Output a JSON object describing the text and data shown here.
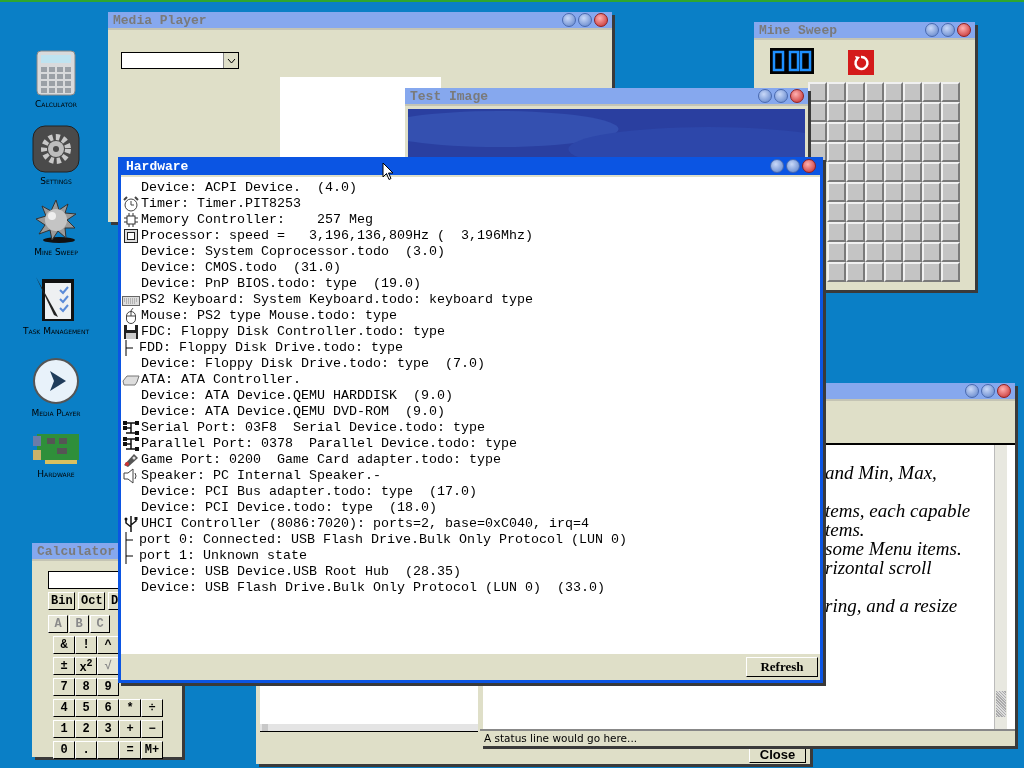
{
  "desktop_icons": [
    {
      "kind": "calculator",
      "label": "Calculator"
    },
    {
      "kind": "settings",
      "label": "Settings"
    },
    {
      "kind": "mine",
      "label": "Mine Sweep"
    },
    {
      "kind": "tasks",
      "label": "Task Management"
    },
    {
      "kind": "media",
      "label": "Media Player"
    },
    {
      "kind": "hardware",
      "label": "Hardware"
    }
  ],
  "media_player": {
    "title": "Media Player",
    "active": false
  },
  "close_window": {
    "button": "Close"
  },
  "text_window": {
    "active": false,
    "paragraphs": [
      [
        "and Min, Max,"
      ],
      [
        "tems, each capable",
        "tems.",
        "some Menu items.",
        "rizontal scroll"
      ],
      [
        "ring, and a resize"
      ]
    ],
    "status": "A status line would go here..."
  },
  "test_image": {
    "title": "Test Image",
    "active": false
  },
  "mine_sweep": {
    "title": "Mine Sweep",
    "active": false
  },
  "calculator": {
    "title": "Calculator",
    "active": false,
    "rows": [
      [
        {
          "label": "Bin",
          "disabled": false
        },
        {
          "label": "Oct",
          "disabled": false
        },
        {
          "label": "D",
          "disabled": false
        }
      ],
      [
        {
          "label": "A",
          "disabled": true
        },
        {
          "label": "B",
          "disabled": true
        },
        {
          "label": "C",
          "disabled": true
        }
      ],
      [
        {
          "label": "&",
          "disabled": false
        },
        {
          "label": "!",
          "disabled": false
        },
        {
          "label": "^",
          "disabled": false
        }
      ],
      [
        {
          "label": "±",
          "disabled": false
        },
        {
          "label": "x$^{2}$",
          "disabled": false
        },
        {
          "label": "√",
          "disabled": true
        }
      ],
      [
        {
          "label": "7",
          "disabled": false
        },
        {
          "label": "8",
          "disabled": false
        },
        {
          "label": "9",
          "disabled": false
        }
      ],
      [
        {
          "label": "4",
          "disabled": false
        },
        {
          "label": "5",
          "disabled": false
        },
        {
          "label": "6",
          "disabled": false
        },
        {
          "label": "*",
          "disabled": false
        },
        {
          "label": "÷",
          "disabled": false
        }
      ],
      [
        {
          "label": "1",
          "disabled": false
        },
        {
          "label": "2",
          "disabled": false
        },
        {
          "label": "3",
          "disabled": false
        },
        {
          "label": "+",
          "disabled": false
        },
        {
          "label": "−",
          "disabled": false
        }
      ],
      [
        {
          "label": "0",
          "disabled": false
        },
        {
          "label": ".",
          "disabled": false
        },
        {
          "disabled": false
        },
        {
          "label": "=",
          "disabled": false
        },
        {
          "label": "M+",
          "disabled": false
        }
      ]
    ]
  },
  "hardware": {
    "title": "Hardware",
    "active": true,
    "button": "Refresh",
    "lines": [
      {
        "kind": "device",
        "text": "Device: ACPI Device.  (4.0)"
      },
      {
        "kind": "timer",
        "text": "Timer: Timer.PIT8253"
      },
      {
        "kind": "memory",
        "text": "Memory Controller:    257 Meg"
      },
      {
        "kind": "processor",
        "text": "Processor: speed =   3,196,136,809Hz (  3,196Mhz)"
      },
      {
        "kind": "device",
        "text": "Device: System Coprocessor.todo  (3.0)"
      },
      {
        "kind": "device",
        "text": "Device: CMOS.todo  (31.0)"
      },
      {
        "kind": "device",
        "text": "Device: PnP BIOS.todo: type  (19.0)"
      },
      {
        "kind": "keyboard",
        "text": "PS2 Keyboard: System Keyboard.todo: keyboard type"
      },
      {
        "kind": "mouse",
        "text": "Mouse: PS2 type Mouse.todo: type"
      },
      {
        "kind": "floppy",
        "text": "FDC: Floppy Disk Controller.todo: type"
      },
      {
        "kind": "branch",
        "text": "FDD: Floppy Disk Drive.todo: type"
      },
      {
        "kind": "device",
        "text": "Device: Floppy Disk Drive.todo: type  (7.0)"
      },
      {
        "kind": "disk",
        "text": "ATA: ATA Controller."
      },
      {
        "kind": "device",
        "text": "Device: ATA Device.QEMU HARDDISK  (9.0)"
      },
      {
        "kind": "device",
        "text": "Device: ATA Device.QEMU DVD-ROM  (9.0)"
      },
      {
        "kind": "serial",
        "text": "Serial Port: 03F8  Serial Device.todo: type"
      },
      {
        "kind": "parallel",
        "text": "Parallel Port: 0378  Parallel Device.todo: type"
      },
      {
        "kind": "game",
        "text": "Game Port: 0200  Game Card adapter.todo: type"
      },
      {
        "kind": "speaker",
        "text": "Speaker: PC Internal Speaker.-"
      },
      {
        "kind": "device",
        "text": "Device: PCI Bus adapter.todo: type  (17.0)"
      },
      {
        "kind": "device",
        "text": "Device: PCI Device.todo: type  (18.0)"
      },
      {
        "kind": "usb",
        "text": "UHCI Controller (8086:7020): ports=2, base=0xC040, irq=4"
      },
      {
        "kind": "branch",
        "text": "port 0: Connected: USB Flash Drive.Bulk Only Protocol (LUN 0)"
      },
      {
        "kind": "branch",
        "text": "port 1: Unknown state"
      },
      {
        "kind": "device",
        "text": "Device: USB Device.USB Root Hub  (28.35)"
      },
      {
        "kind": "device",
        "text": "Device: USB Flash Drive.Bulk Only Protocol (LUN 0)  (33.0)"
      }
    ]
  }
}
